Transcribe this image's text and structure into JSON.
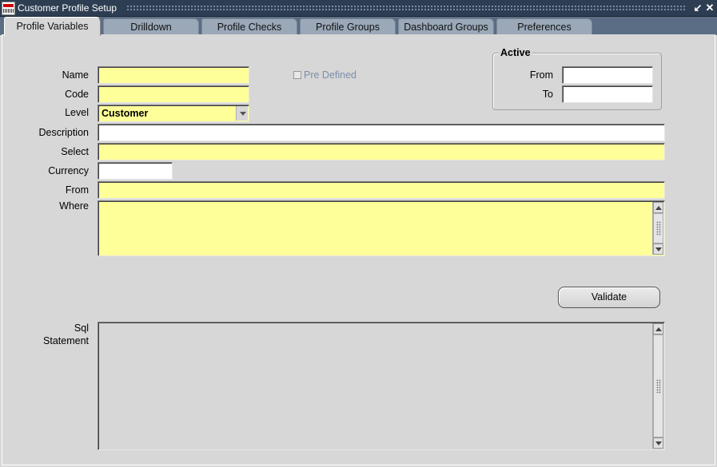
{
  "window": {
    "title": "Customer Profile Setup"
  },
  "tabs": [
    {
      "label": "Profile Variables",
      "active": true
    },
    {
      "label": "Drilldown",
      "active": false
    },
    {
      "label": "Profile Checks",
      "active": false
    },
    {
      "label": "Profile Groups",
      "active": false
    },
    {
      "label": "Dashboard Groups",
      "active": false
    },
    {
      "label": "Preferences",
      "active": false
    }
  ],
  "form": {
    "name_label": "Name",
    "name_value": "",
    "code_label": "Code",
    "code_value": "",
    "level_label": "Level",
    "level_value": "Customer",
    "predefined_label": "Pre Defined",
    "predefined_checked": false,
    "description_label": "Description",
    "description_value": "",
    "select_label": "Select",
    "select_value": "",
    "currency_label": "Currency",
    "currency_value": "",
    "from_label": "From",
    "from_value": "",
    "where_label": "Where",
    "where_value": "",
    "sql_label_line1": "Sql",
    "sql_label_line2": "Statement",
    "sql_value": ""
  },
  "active": {
    "group_title": "Active",
    "from_label": "From",
    "from_value": "",
    "to_label": "To",
    "to_value": ""
  },
  "buttons": {
    "validate_label": "Validate"
  },
  "colors": {
    "required_field": "#ffff99",
    "title_bar": "#2e3e52",
    "tab_strip": "#5a6d85",
    "background": "#d7d7d7"
  }
}
